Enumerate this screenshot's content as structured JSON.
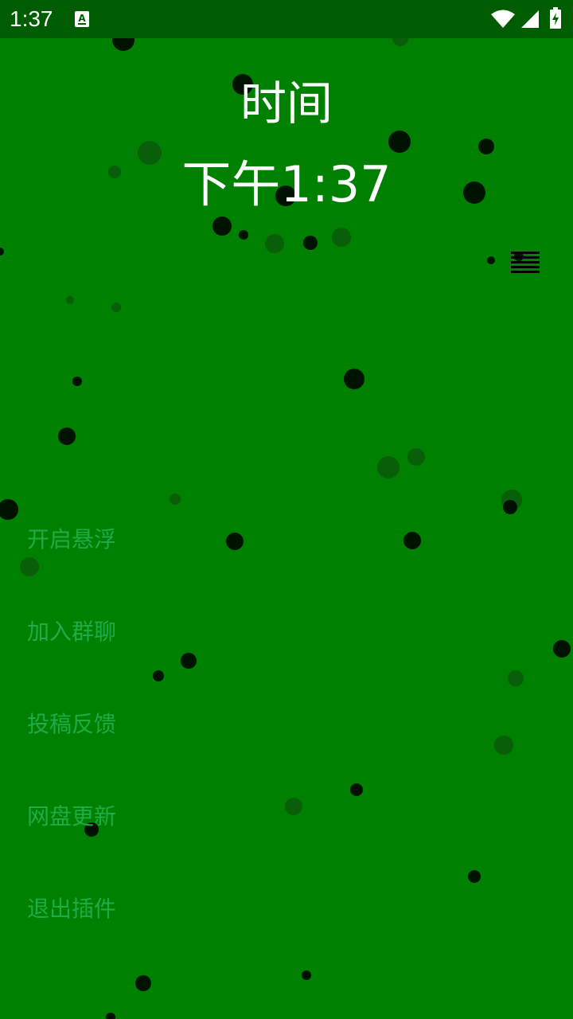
{
  "status_bar": {
    "time": "1:37",
    "icons": [
      "app-notification-icon",
      "wifi-icon",
      "cell-signal-icon",
      "battery-charging-icon"
    ]
  },
  "header": {
    "title": "时间",
    "clock": "下午1:37"
  },
  "menu_button": {
    "icon": "hamburger-menu-icon"
  },
  "menu_items": [
    {
      "label": "开启悬浮"
    },
    {
      "label": "加入群聊"
    },
    {
      "label": "投稿反馈"
    },
    {
      "label": "网盘更新"
    },
    {
      "label": "退出插件"
    }
  ],
  "colors": {
    "background": "#008000",
    "status_bar": "#005c00",
    "menu_text": "#1eab4a",
    "title_text": "#ffffff",
    "bubble_dark": "#000000",
    "bubble_light": "#0a5a0a"
  }
}
